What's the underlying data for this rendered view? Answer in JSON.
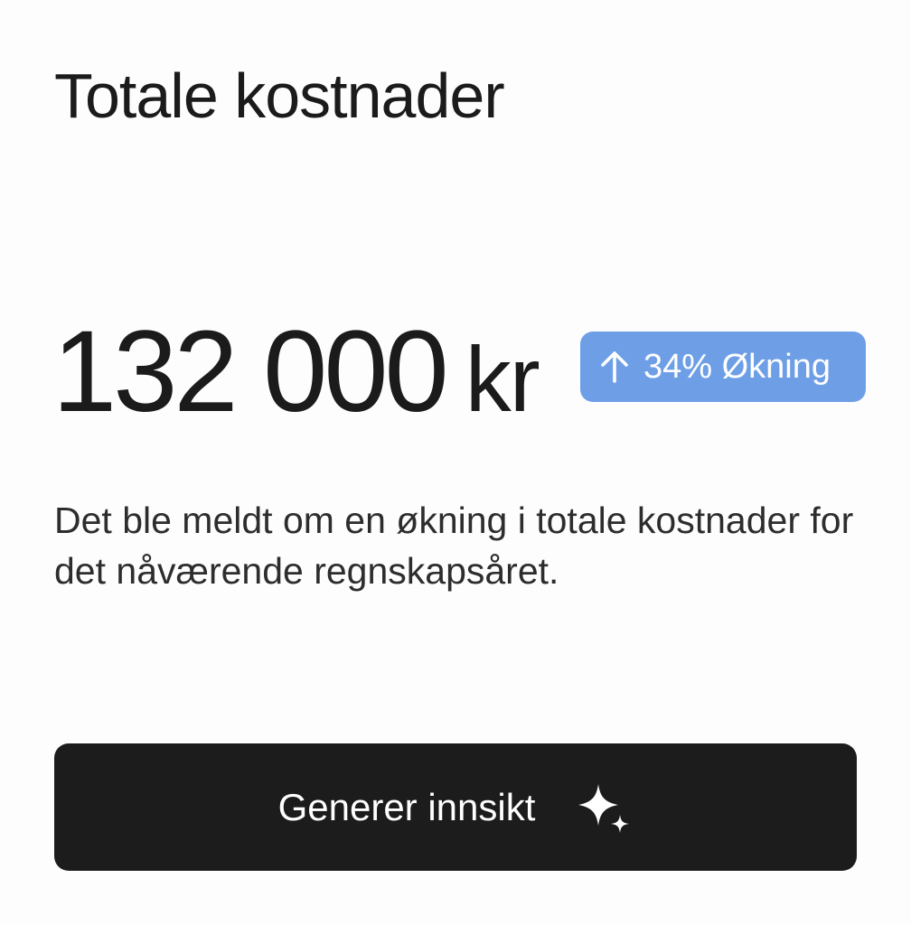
{
  "card": {
    "title": "Totale kostnader",
    "amount_value": "132 000",
    "amount_unit": "kr",
    "badge": {
      "text": "34% Økning",
      "icon": "arrow-up-icon",
      "color": "#6e9fe6"
    },
    "description": "Det ble meldt om en økning i totale kostnader for det nåværende regnskapsåret.",
    "cta": {
      "label": "Generer innsikt",
      "icon": "sparkle-icon",
      "color": "#1d1c1c"
    }
  }
}
